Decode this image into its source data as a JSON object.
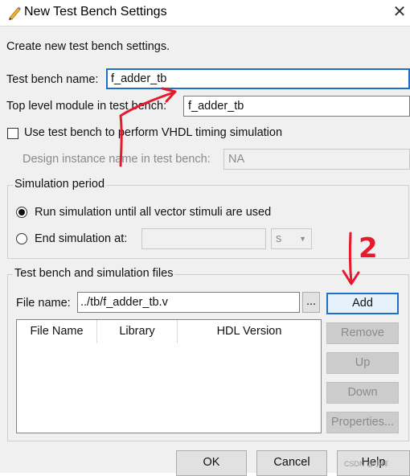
{
  "window": {
    "title": "New Test Bench Settings",
    "close_glyph": "✕"
  },
  "intro_text": "Create new test bench settings.",
  "test_bench_name": {
    "label": "Test bench name:",
    "value": "f_adder_tb"
  },
  "top_level_module": {
    "label": "Top level module in test bench:",
    "value": "f_adder_tb"
  },
  "vhdl_timing": {
    "label": "Use test bench to perform VHDL timing simulation",
    "checked": false
  },
  "design_instance": {
    "label": "Design instance name in test bench:",
    "value": "NA"
  },
  "simulation_period": {
    "title": "Simulation period",
    "run_all_label": "Run simulation until all vector stimuli are used",
    "end_at_label": "End simulation at:",
    "end_at_value": "",
    "unit": "s",
    "selected": "run_all"
  },
  "files_group": {
    "title": "Test bench and simulation files",
    "file_name_label": "File name:",
    "file_name_value": "../tb/f_adder_tb.v",
    "browse_label": "...",
    "columns": [
      "File Name",
      "Library",
      "HDL Version"
    ],
    "add_label": "Add",
    "remove_label": "Remove",
    "up_label": "Up",
    "down_label": "Down",
    "properties_label": "Properties..."
  },
  "footer": {
    "ok_label": "OK",
    "cancel_label": "Cancel",
    "help_label": "Help"
  },
  "annotations": {
    "mark_1": "1",
    "mark_2": "2",
    "watermark": "CSDN @小样"
  },
  "colors": {
    "focus_border": "#1f6fc6",
    "annotation_red": "#e8192c",
    "dialog_bg": "#f0f0f0"
  }
}
